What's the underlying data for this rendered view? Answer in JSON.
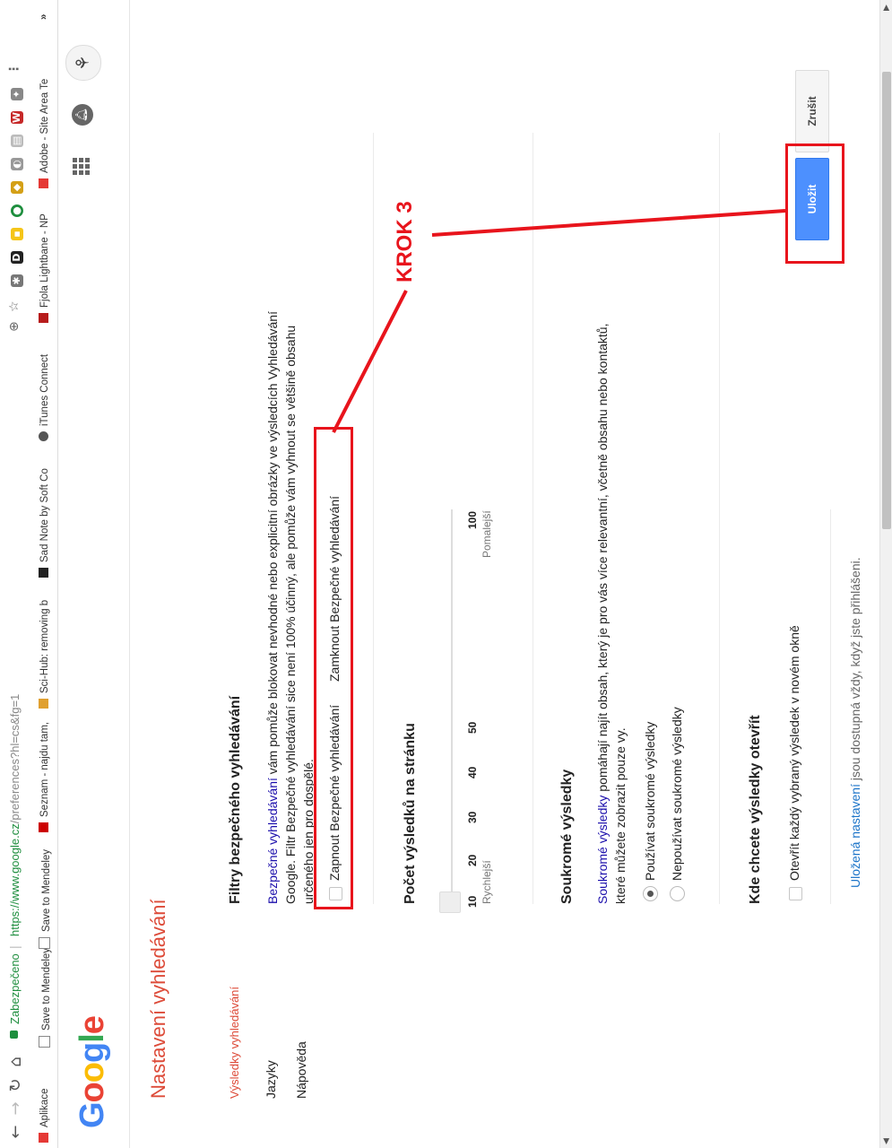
{
  "browser": {
    "secure_label": "Zabezpečeno",
    "url_host": "https://www.google.cz",
    "url_path": "/preferences?hl=cs&fg=1"
  },
  "bookmarks": [
    {
      "label": "Aplikace",
      "color": "#e53935"
    },
    {
      "label": "Save to Mendeley",
      "color": "#888888"
    },
    {
      "label": "Save to Mendeley",
      "color": "#888888"
    },
    {
      "label": "Seznam - najdu tam,",
      "color": "#cc0000"
    },
    {
      "label": "Sci-Hub: removing b",
      "color": "#e0a030"
    },
    {
      "label": "Sad Note by Soft Co",
      "color": "#222222"
    },
    {
      "label": "iTunes Connect",
      "color": "#555555"
    },
    {
      "label": "Fjola Lightbane - NP",
      "color": "#b71c1c"
    },
    {
      "label": "Adobe - Site Area Te",
      "color": "#e53935"
    }
  ],
  "header": {
    "logo_letters": [
      {
        "ch": "G",
        "color": "#4285f4"
      },
      {
        "ch": "o",
        "color": "#ea4335"
      },
      {
        "ch": "o",
        "color": "#fbbc05"
      },
      {
        "ch": "g",
        "color": "#4285f4"
      },
      {
        "ch": "l",
        "color": "#34a853"
      },
      {
        "ch": "e",
        "color": "#ea4335"
      }
    ]
  },
  "page_title": "Nastavení vyhledávání",
  "sidebar": {
    "items": [
      {
        "label": "Výsledky vyhledávání"
      },
      {
        "label": "Jazyky"
      },
      {
        "label": "Nápověda"
      }
    ]
  },
  "safesearch": {
    "title": "Filtry bezpečného vyhledávání",
    "link_text": "Bezpečné vyhledávání",
    "desc_line1": " vám pomůže blokovat nevhodné nebo explicitní obrázky ve výsledcích Vyhledávání",
    "desc_line2": "Google. Filtr Bezpečné vyhledávání sice není 100% účinný, ale pomůže vám vyhnout se většině obsahu",
    "desc_line3": "určeného jen pro dospělé.",
    "checkbox_label": "Zapnout Bezpečné vyhledávání",
    "lock_link": "Zamknout Bezpečné vyhledávání"
  },
  "results_per_page": {
    "title": "Počet výsledků na stránku",
    "ticks": [
      "10",
      "20",
      "30",
      "40",
      "50",
      "100"
    ],
    "faster_label": "Rychlejší",
    "slower_label": "Pomalejší"
  },
  "private_results": {
    "title": "Soukromé výsledky",
    "link_text": "Soukromé výsledky",
    "desc_line1": " pomáhají najít obsah, který je pro vás více relevantní, včetně obsahu nebo kontaktů,",
    "desc_line2": "které můžete zobrazit pouze vy.",
    "option_use": "Používat soukromé výsledky",
    "option_dont": "Nepoužívat soukromé výsledky"
  },
  "open_results": {
    "title": "Kde chcete výsledky otevřít",
    "checkbox_label": "Otevřít každý vybraný výsledek v novém okně"
  },
  "buttons": {
    "save": "Uložit",
    "cancel": "Zrušit"
  },
  "footer": {
    "link_text": "Uložená nastavení",
    "rest": " jsou dostupná vždy, když jste přihlášeni."
  },
  "annotation": {
    "label": "KROK 3",
    "color": "#e8141c"
  }
}
